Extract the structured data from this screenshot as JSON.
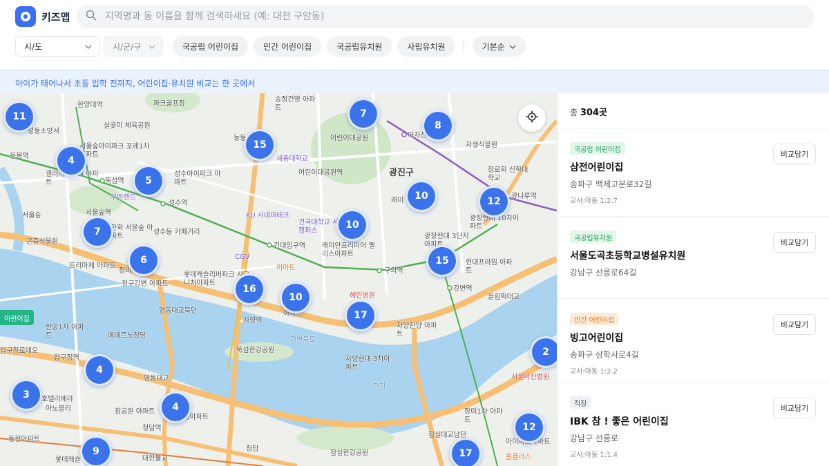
{
  "app": {
    "name": "키즈맵",
    "brand_color": "#3b6ef5"
  },
  "search": {
    "placeholder": "지역명과 동 이름을 함께 검색하세요 (예: 대전 구암동)",
    "value": ""
  },
  "filters": {
    "sido": "시/도",
    "sigungu": "시/군/구",
    "chips": [
      "국공립 어린이집",
      "민간 어린이집",
      "국공립유치원",
      "사립유치원"
    ],
    "sort": "기본순"
  },
  "banner": "아이가 태어나서 초등 입학 전까지, 어린이집·유치원 비교는 한 곳에서",
  "map": {
    "districts": [
      "광진구"
    ],
    "clusters": [
      "11",
      "4",
      "5",
      "15",
      "7",
      "8",
      "10",
      "12",
      "7",
      "6",
      "10",
      "15",
      "16",
      "10",
      "17",
      "2",
      "4",
      "3",
      "4",
      "12",
      "9",
      "17"
    ],
    "places": [
      "한양대역",
      "성동소방서",
      "살곶이 체육공원",
      "응봉역",
      "서울숲아이파크 포레1차아파트",
      "갤러리아포레 아파트",
      "뚝섬역",
      "성수아이파크 아파트",
      "무빈랜드",
      "성수역",
      "서울숲역",
      "서울숲",
      "한화 서울숲 아파트",
      "성수동 카페거리",
      "곤충식물원",
      "트리마제 아파트",
      "청구강변 아파트",
      "정비",
      "어린이대공원역",
      "세종대학교",
      "어린이대공원",
      "능동로",
      "건국대학교 서울캠퍼스",
      "KU 시네마테크",
      "건대입구역",
      "CGV",
      "래미안프리미어 팰리스아파트",
      "이마트",
      "롯데캐슬리버파크 시그니처아파트",
      "혜민병원",
      "자양역",
      "아파트",
      "자양한양 아파트",
      "뚝섬한강공원",
      "자양현대 3차아파트",
      "구의역",
      "현대프라임 아파트",
      "강변역",
      "아차산역",
      "자생식물원",
      "장로회 신학대학교",
      "광장현대 10차아파트",
      "광장현대 3단지아파트",
      "래미 스위트",
      "광나루역",
      "영동대교북단",
      "한양1차 아파트",
      "에데르노청담",
      "압구정로데오",
      "압구정역",
      "호텔리베라",
      "아노블리",
      "영동대교",
      "참공원 아파트",
      "청담역",
      "대한불교",
      "동현아파트",
      "롯데캐슬",
      "삼성아파트",
      "잠실대교남단",
      "잠실한강공원",
      "장미1차 아파트",
      "아이파크아파트",
      "홈플러스",
      "서울아산병원",
      "올림픽대교",
      "청담",
      "강변북로",
      "파크골프장",
      "송정건영 아파트",
      "한강"
    ],
    "edge_tag": "어린이집"
  },
  "list": {
    "total_prefix": "총",
    "total_count": "304곳",
    "compare_label": "비교담기",
    "items": [
      {
        "badge": "국공립 어린이집",
        "badge_type": "public-daycare",
        "name": "삼전어린이집",
        "address": "송파구 백제고분로32길",
        "ratio": "교사:아동 1:2.7"
      },
      {
        "badge": "국공립유치원",
        "badge_type": "public-kinder",
        "name": "서울도곡초등학교병설유치원",
        "address": "강남구 선릉로64길",
        "ratio": ""
      },
      {
        "badge": "민간 어린이집",
        "badge_type": "private-daycare",
        "name": "빙고어린이집",
        "address": "송파구 삼학사로4길",
        "ratio": "교사:아동 1:2.2"
      },
      {
        "badge": "직장",
        "badge_type": "workplace",
        "name": "IBK 참 ! 좋은 어린이집",
        "address": "강남구 선릉로",
        "ratio": "교사:아동 1:1.4"
      }
    ]
  },
  "colors": {
    "cluster": "#3b73ea",
    "public_daycare_badge_bg": "#e3f6ea",
    "public_daycare_badge_fg": "#1c9a55",
    "private_daycare_badge_bg": "#fdebd9",
    "private_daycare_badge_fg": "#e0792a",
    "workplace_badge_bg": "#eef0f3",
    "workplace_badge_fg": "#555555"
  }
}
